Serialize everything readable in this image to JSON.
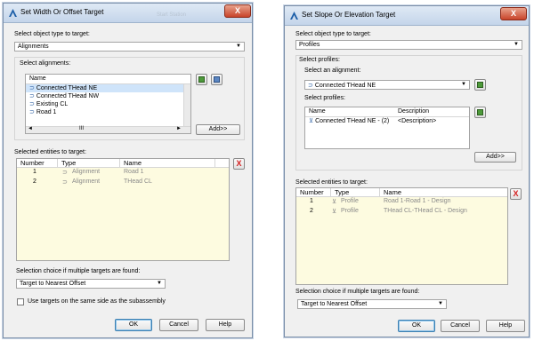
{
  "left_dialog": {
    "title": "Set Width Or Offset Target",
    "ghost_title": "Start Station",
    "close_label": "X",
    "object_type_label": "Select object type to target:",
    "object_type_value": "Alignments",
    "alignments_group_label": "Select alignments:",
    "alignments_list_header": "Name",
    "alignments": [
      "Connected THead NE",
      "Connected THead NW",
      "Existing CL",
      "Road 1"
    ],
    "scroll_left": "◄",
    "scroll_thumb": "III",
    "scroll_right": "►",
    "add_button": "Add>>",
    "selected_label": "Selected entities to target:",
    "columns": [
      "Number",
      "Type",
      "Name"
    ],
    "rows": [
      {
        "number": "1",
        "type": "Alignment",
        "name": "Road 1"
      },
      {
        "number": "2",
        "type": "Alignment",
        "name": "THead CL"
      }
    ],
    "delete_label": "X",
    "multiple_label": "Selection choice if multiple targets are found:",
    "multiple_value": "Target to Nearest Offset",
    "checkbox_label": "Use targets on the same side as the subassembly",
    "ok": "OK",
    "cancel": "Cancel",
    "help": "Help"
  },
  "right_dialog": {
    "title": "Set Slope Or Elevation Target",
    "close_label": "X",
    "object_type_label": "Select object type to target:",
    "object_type_value": "Profiles",
    "profiles_group_label": "Select profiles:",
    "alignment_label": "Select an alignment:",
    "alignment_value": "Connected THead NE",
    "profiles_label": "Select profiles:",
    "profile_columns": [
      "Name",
      "Description"
    ],
    "profile_rows": [
      {
        "name": "Connected THead NE - (2)",
        "description": "<Description>"
      }
    ],
    "add_button": "Add>>",
    "selected_label": "Selected entities to target:",
    "columns": [
      "Number",
      "Type",
      "Name"
    ],
    "rows": [
      {
        "number": "1",
        "type": "Profile",
        "name": "Road 1-Road 1 - Design"
      },
      {
        "number": "2",
        "type": "Profile",
        "name": "THead CL-THead CL - Design"
      }
    ],
    "delete_label": "X",
    "multiple_label": "Selection choice if multiple targets are found:",
    "multiple_value": "Target to Nearest Offset",
    "ok": "OK",
    "cancel": "Cancel",
    "help": "Help"
  },
  "icons": {
    "app": "autodesk-a-icon",
    "alignment": "alignment-icon",
    "profile": "profile-icon",
    "pick": "pick-from-drawing-icon",
    "dropdown": "chevron-down-icon"
  },
  "colors": {
    "grid_background": "#fdfbe0",
    "close_button": "#c8442a",
    "delete_x": "#d41e1e",
    "selection_highlight": "#cfe4fa"
  }
}
